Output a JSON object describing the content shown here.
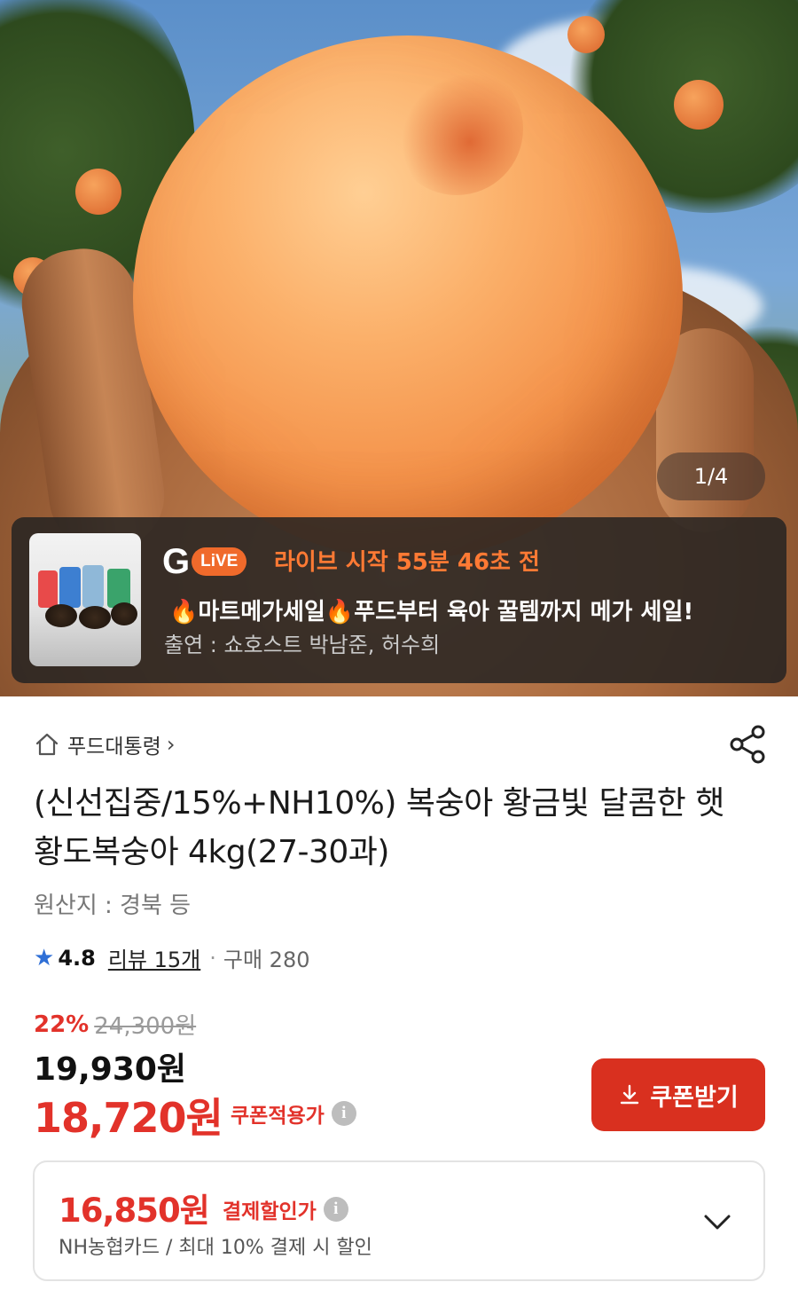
{
  "gallery": {
    "counter": "1/4"
  },
  "live_banner": {
    "logo_g": "G",
    "logo_live": "LiVE",
    "countdown": "라이브 시작 55분 46초 전",
    "headline": {
      "fire1": "🔥",
      "part1": "마트메가세일",
      "fire2": "🔥",
      "part2": "푸드부터 육아 꿀템까지 메가 세일!"
    },
    "hosts": "출연 : 쇼호스트 박남준, 허수희"
  },
  "breadcrumb": {
    "label": "푸드대통령",
    "chevron": "›"
  },
  "product": {
    "title": "(신선집중/15%+NH10%) 복숭아 황금빛 달콤한 햇 황도복숭아 4kg(27-30과)",
    "origin": "원산지 : 경북  등",
    "rating": {
      "star": "★",
      "score": "4.8",
      "review": "리뷰 15개",
      "dot": "·",
      "purchases": "구매 280"
    },
    "pricing": {
      "discount_pct": "22%",
      "original_price": "24,300원",
      "sale_price": "19,930원",
      "coupon_price": "18,720원",
      "coupon_label": "쿠폰적용가",
      "info": "i"
    },
    "coupon_button": "쿠폰받기",
    "payment": {
      "price": "16,850원",
      "label": "결제할인가",
      "info": "i",
      "description": "NH농협카드 / 최대 10% 결제 시 할인"
    }
  },
  "colors": {
    "accent_red": "#e2322a",
    "button_red": "#d9301f",
    "live_orange": "#ff7a34",
    "star_blue": "#2f6fd6"
  }
}
